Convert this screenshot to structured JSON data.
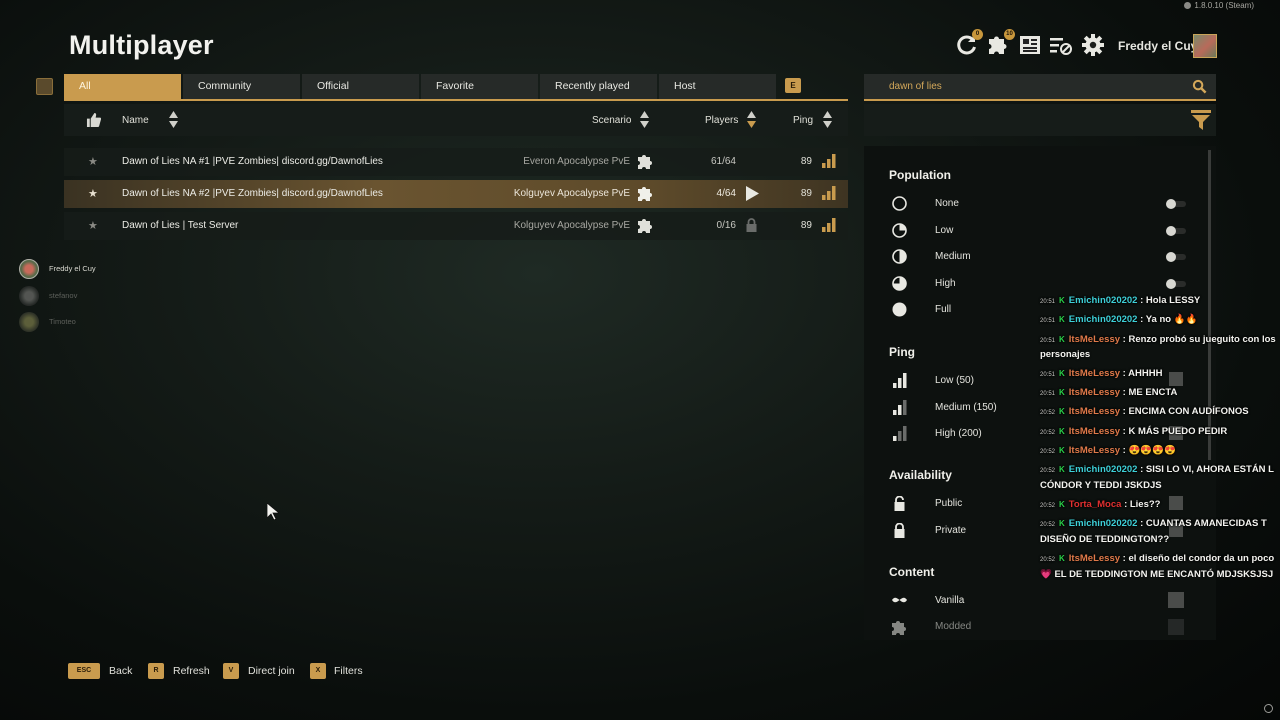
{
  "header": {
    "title": "Multiplayer",
    "version": "1.8.0.10 (Steam)",
    "username": "Freddy el Cuy",
    "badges": {
      "refresh": "0",
      "mods": "10"
    }
  },
  "tabs": [
    "All",
    "Community",
    "Official",
    "Favorite",
    "Recently played",
    "Host"
  ],
  "tabs_hotkey": "E",
  "search": {
    "value": "dawn of lies"
  },
  "columns": {
    "name": "Name",
    "scenario": "Scenario",
    "players": "Players",
    "ping": "Ping"
  },
  "servers": [
    {
      "name": "Dawn of Lies NA #1 |PVE Zombies| discord.gg/DawnofLies",
      "scenario": "Everon Apocalypse PvE",
      "players": "61/64",
      "ping": "89"
    },
    {
      "name": "Dawn of Lies NA #2 |PVE Zombies| discord.gg/DawnofLies",
      "scenario": "Kolguyev Apocalypse PvE",
      "players": "4/64",
      "ping": "89"
    },
    {
      "name": "Dawn of Lies | Test Server",
      "scenario": "Kolguyev Apocalypse PvE",
      "players": "0/16",
      "ping": "89"
    }
  ],
  "friends": [
    "Freddy el Cuy",
    "stefanov",
    "Timoteo"
  ],
  "filters": {
    "population": {
      "title": "Population",
      "options": [
        "None",
        "Low",
        "Medium",
        "High",
        "Full"
      ]
    },
    "ping": {
      "title": "Ping",
      "options": [
        "Low (50)",
        "Medium (150)",
        "High (200)"
      ]
    },
    "availability": {
      "title": "Availability",
      "options": [
        "Public",
        "Private"
      ]
    },
    "content": {
      "title": "Content",
      "options": [
        "Vanilla",
        "Modded"
      ]
    }
  },
  "chat": [
    {
      "time": "20:51",
      "user": "Emichin020202",
      "color": "#3ed0d8",
      "msg": ": Hola LESSY"
    },
    {
      "time": "20:51",
      "user": "Emichin020202",
      "color": "#3ed0d8",
      "msg": ": Ya no 🔥🔥"
    },
    {
      "time": "20:51",
      "user": "ItsMeLessy",
      "color": "#e07a4a",
      "msg": ": Renzo probó su jueguito con los",
      "cont": "personajes"
    },
    {
      "time": "20:51",
      "user": "ItsMeLessy",
      "color": "#e07a4a",
      "msg": ": AHHHH"
    },
    {
      "time": "20:51",
      "user": "ItsMeLessy",
      "color": "#e07a4a",
      "msg": ": ME ENCTA"
    },
    {
      "time": "20:52",
      "user": "ItsMeLessy",
      "color": "#e07a4a",
      "msg": ": ENCIMA CON AUDÍFONOS"
    },
    {
      "time": "20:52",
      "user": "ItsMeLessy",
      "color": "#e07a4a",
      "msg": ": K MÁS PUEDO PEDIR"
    },
    {
      "time": "20:52",
      "user": "ItsMeLessy",
      "color": "#e07a4a",
      "msg": ": 😍😍😍😍"
    },
    {
      "time": "20:52",
      "user": "Emichin020202",
      "color": "#3ed0d8",
      "msg": ": SISI LO VI, AHORA ESTÁN L",
      "cont": "CÓNDOR Y TEDDI JSKDJS"
    },
    {
      "time": "20:52",
      "user": "Torta_Moca",
      "color": "#e03030",
      "msg": ": Lies??"
    },
    {
      "time": "20:52",
      "user": "Emichin020202",
      "color": "#3ed0d8",
      "msg": ": CUANTAS AMANECIDAS T",
      "cont": "DISEÑO DE TEDDINGTON??"
    },
    {
      "time": "20:52",
      "user": "ItsMeLessy",
      "color": "#e07a4a",
      "msg": ": el diseño del condor da un poco",
      "cont": "💗 EL DE TEDDINGTON ME ENCANTÓ MDJSKSJSJ"
    }
  ],
  "bottom": [
    {
      "key": "ESC",
      "label": "Back"
    },
    {
      "key": "R",
      "label": "Refresh"
    },
    {
      "key": "V",
      "label": "Direct join"
    },
    {
      "key": "X",
      "label": "Filters"
    }
  ],
  "colors": {
    "accent": "#c99b4e",
    "panel": "#262a28"
  }
}
